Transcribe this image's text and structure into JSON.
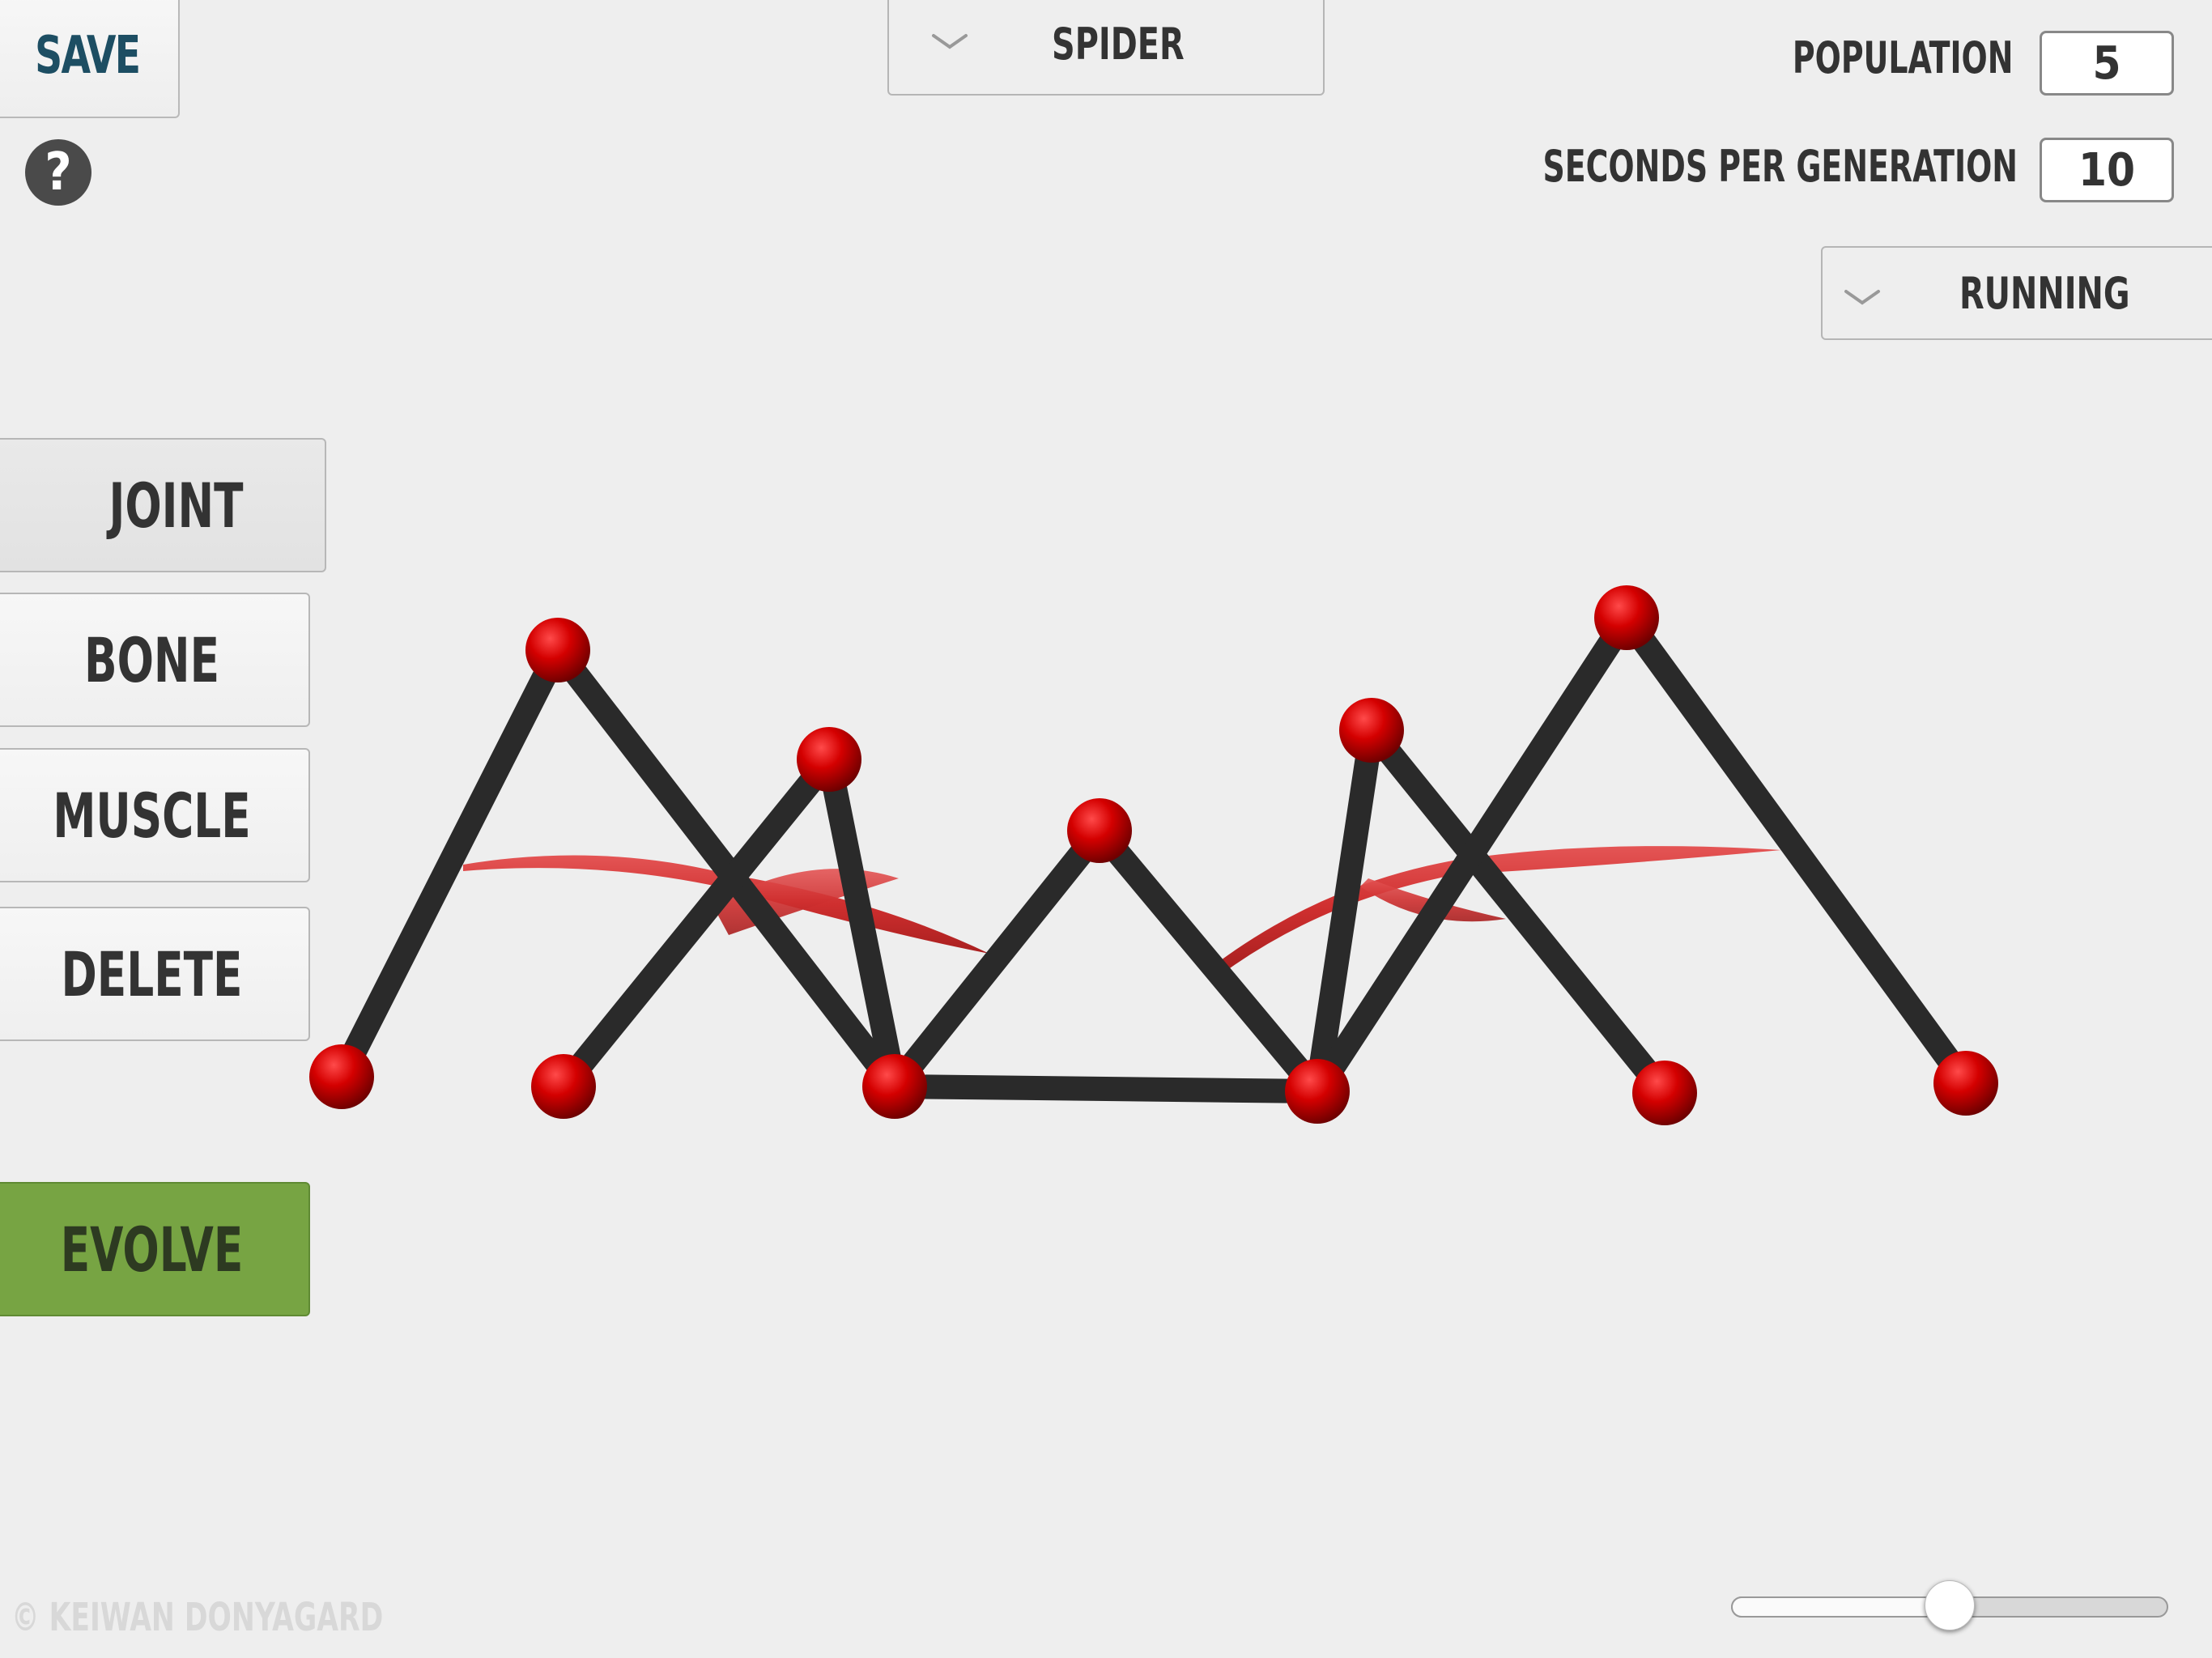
{
  "toolbar": {
    "save_label": "SAVE"
  },
  "help": {
    "glyph": "?"
  },
  "creature_select": {
    "selected": "SPIDER"
  },
  "settings": {
    "population_label": "POPULATION",
    "population_value": "5",
    "seconds_label": "SECONDS PER GENERATION",
    "seconds_value": "10"
  },
  "task_select": {
    "selected": "RUNNING"
  },
  "tools": {
    "joint": "JOINT",
    "bone": "BONE",
    "muscle": "MUSCLE",
    "delete": "DELETE",
    "evolve": "EVOLVE"
  },
  "simulation_speed": {
    "value": 0.5
  },
  "credit": "© KEIWAN DONYAGARD",
  "colors": {
    "joint": "#cc0000",
    "bone": "#2a2a2a",
    "muscle": "#cf3a3a",
    "evolve": "#77a443",
    "save_text": "#1d4e63"
  },
  "icons": {
    "help": "question-mark-icon",
    "dropdown": "chevron-down-icon"
  }
}
